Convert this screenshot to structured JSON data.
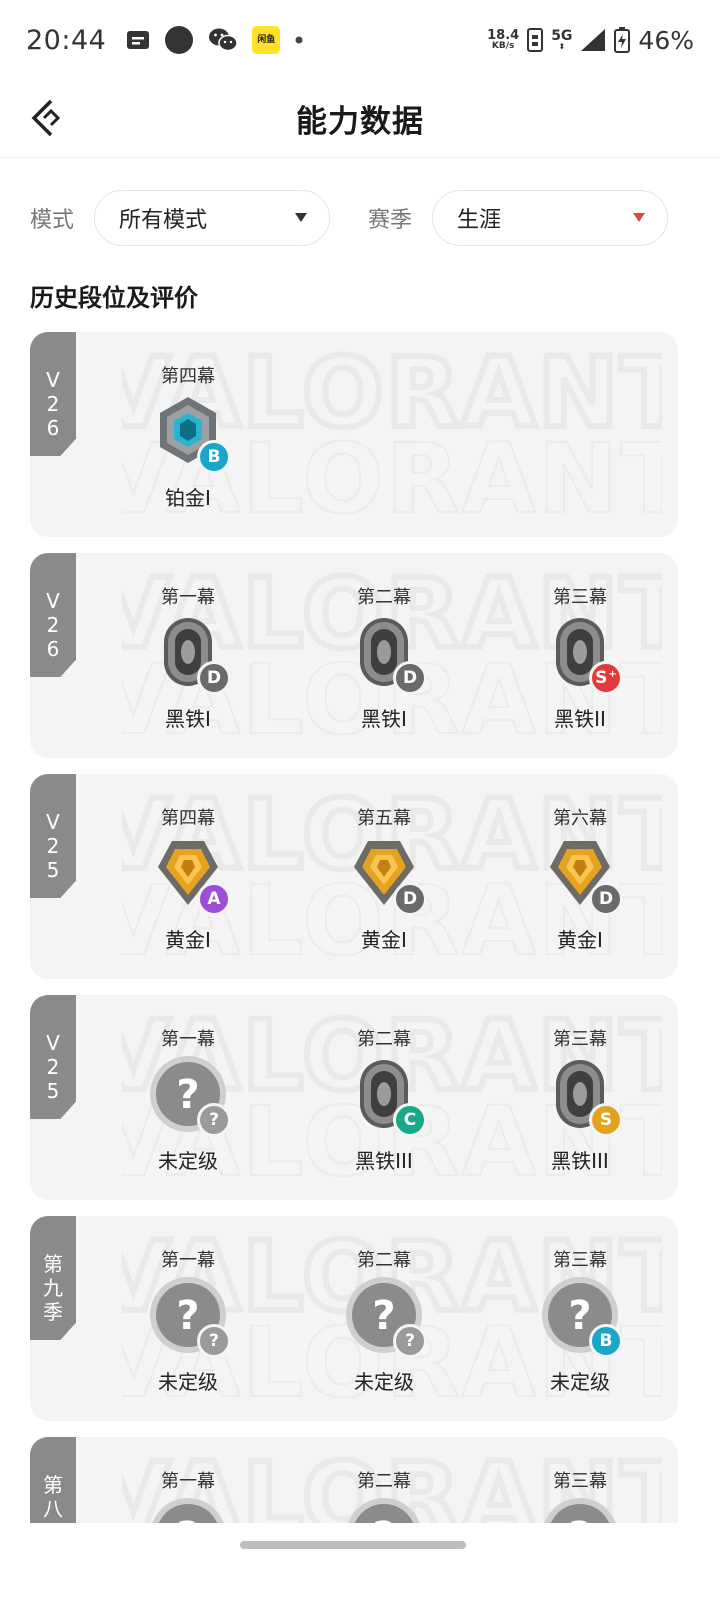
{
  "status_bar": {
    "time": "20:44",
    "app_icon_text": "闲鱼",
    "net_speed_value": "18.4",
    "net_speed_unit": "KB/s",
    "network": "5G",
    "battery": "46%"
  },
  "header": {
    "title": "能力数据"
  },
  "filters": {
    "mode_label": "模式",
    "mode_value": "所有模式",
    "season_label": "赛季",
    "season_value": "生涯"
  },
  "section_title": "历史段位及评价",
  "watermark_text": "VALORANT",
  "cards": [
    {
      "tag": "V\n26",
      "acts": [
        {
          "name": "第四幕",
          "rank": "铂金I",
          "rank_icon": "platinum-rank-icon",
          "grade": "B",
          "grade_color": "#1aa6c8"
        }
      ]
    },
    {
      "tag": "V\n26",
      "acts": [
        {
          "name": "第一幕",
          "rank": "黑铁I",
          "rank_icon": "iron-rank-icon",
          "grade": "D",
          "grade_color": "#6a6a6a"
        },
        {
          "name": "第二幕",
          "rank": "黑铁I",
          "rank_icon": "iron-rank-icon",
          "grade": "D",
          "grade_color": "#6a6a6a"
        },
        {
          "name": "第三幕",
          "rank": "黑铁II",
          "rank_icon": "iron-rank-icon",
          "grade": "S",
          "grade_sup": "+",
          "grade_color": "#e23a3a"
        }
      ]
    },
    {
      "tag": "V\n25",
      "acts": [
        {
          "name": "第四幕",
          "rank": "黄金I",
          "rank_icon": "gold-rank-icon",
          "grade": "A",
          "grade_color": "#9c4fd6"
        },
        {
          "name": "第五幕",
          "rank": "黄金I",
          "rank_icon": "gold-rank-icon",
          "grade": "D",
          "grade_color": "#6a6a6a"
        },
        {
          "name": "第六幕",
          "rank": "黄金I",
          "rank_icon": "gold-rank-icon",
          "grade": "D",
          "grade_color": "#6a6a6a"
        }
      ]
    },
    {
      "tag": "V\n25",
      "acts": [
        {
          "name": "第一幕",
          "rank": "未定级",
          "rank_icon": "unranked-icon",
          "grade": "?",
          "grade_color": "#9a9a9a"
        },
        {
          "name": "第二幕",
          "rank": "黑铁III",
          "rank_icon": "iron-rank-icon",
          "grade": "C",
          "grade_color": "#19a98a"
        },
        {
          "name": "第三幕",
          "rank": "黑铁III",
          "rank_icon": "iron-rank-icon",
          "grade": "S",
          "grade_color": "#e2a21f"
        }
      ]
    },
    {
      "tag": "第九季",
      "acts": [
        {
          "name": "第一幕",
          "rank": "未定级",
          "rank_icon": "unranked-icon",
          "grade": "?",
          "grade_color": "#9a9a9a"
        },
        {
          "name": "第二幕",
          "rank": "未定级",
          "rank_icon": "unranked-icon",
          "grade": "?",
          "grade_color": "#9a9a9a"
        },
        {
          "name": "第三幕",
          "rank": "未定级",
          "rank_icon": "unranked-icon",
          "grade": "B",
          "grade_color": "#1aa6c8"
        }
      ]
    },
    {
      "tag": "第八季",
      "acts": [
        {
          "name": "第一幕",
          "rank": "",
          "rank_icon": "unranked-icon",
          "grade": "",
          "grade_color": "#9a9a9a"
        },
        {
          "name": "第二幕",
          "rank": "",
          "rank_icon": "unranked-icon",
          "grade": "",
          "grade_color": "#9a9a9a"
        },
        {
          "name": "第三幕",
          "rank": "",
          "rank_icon": "unranked-icon",
          "grade": "",
          "grade_color": "#9a9a9a"
        }
      ]
    }
  ]
}
